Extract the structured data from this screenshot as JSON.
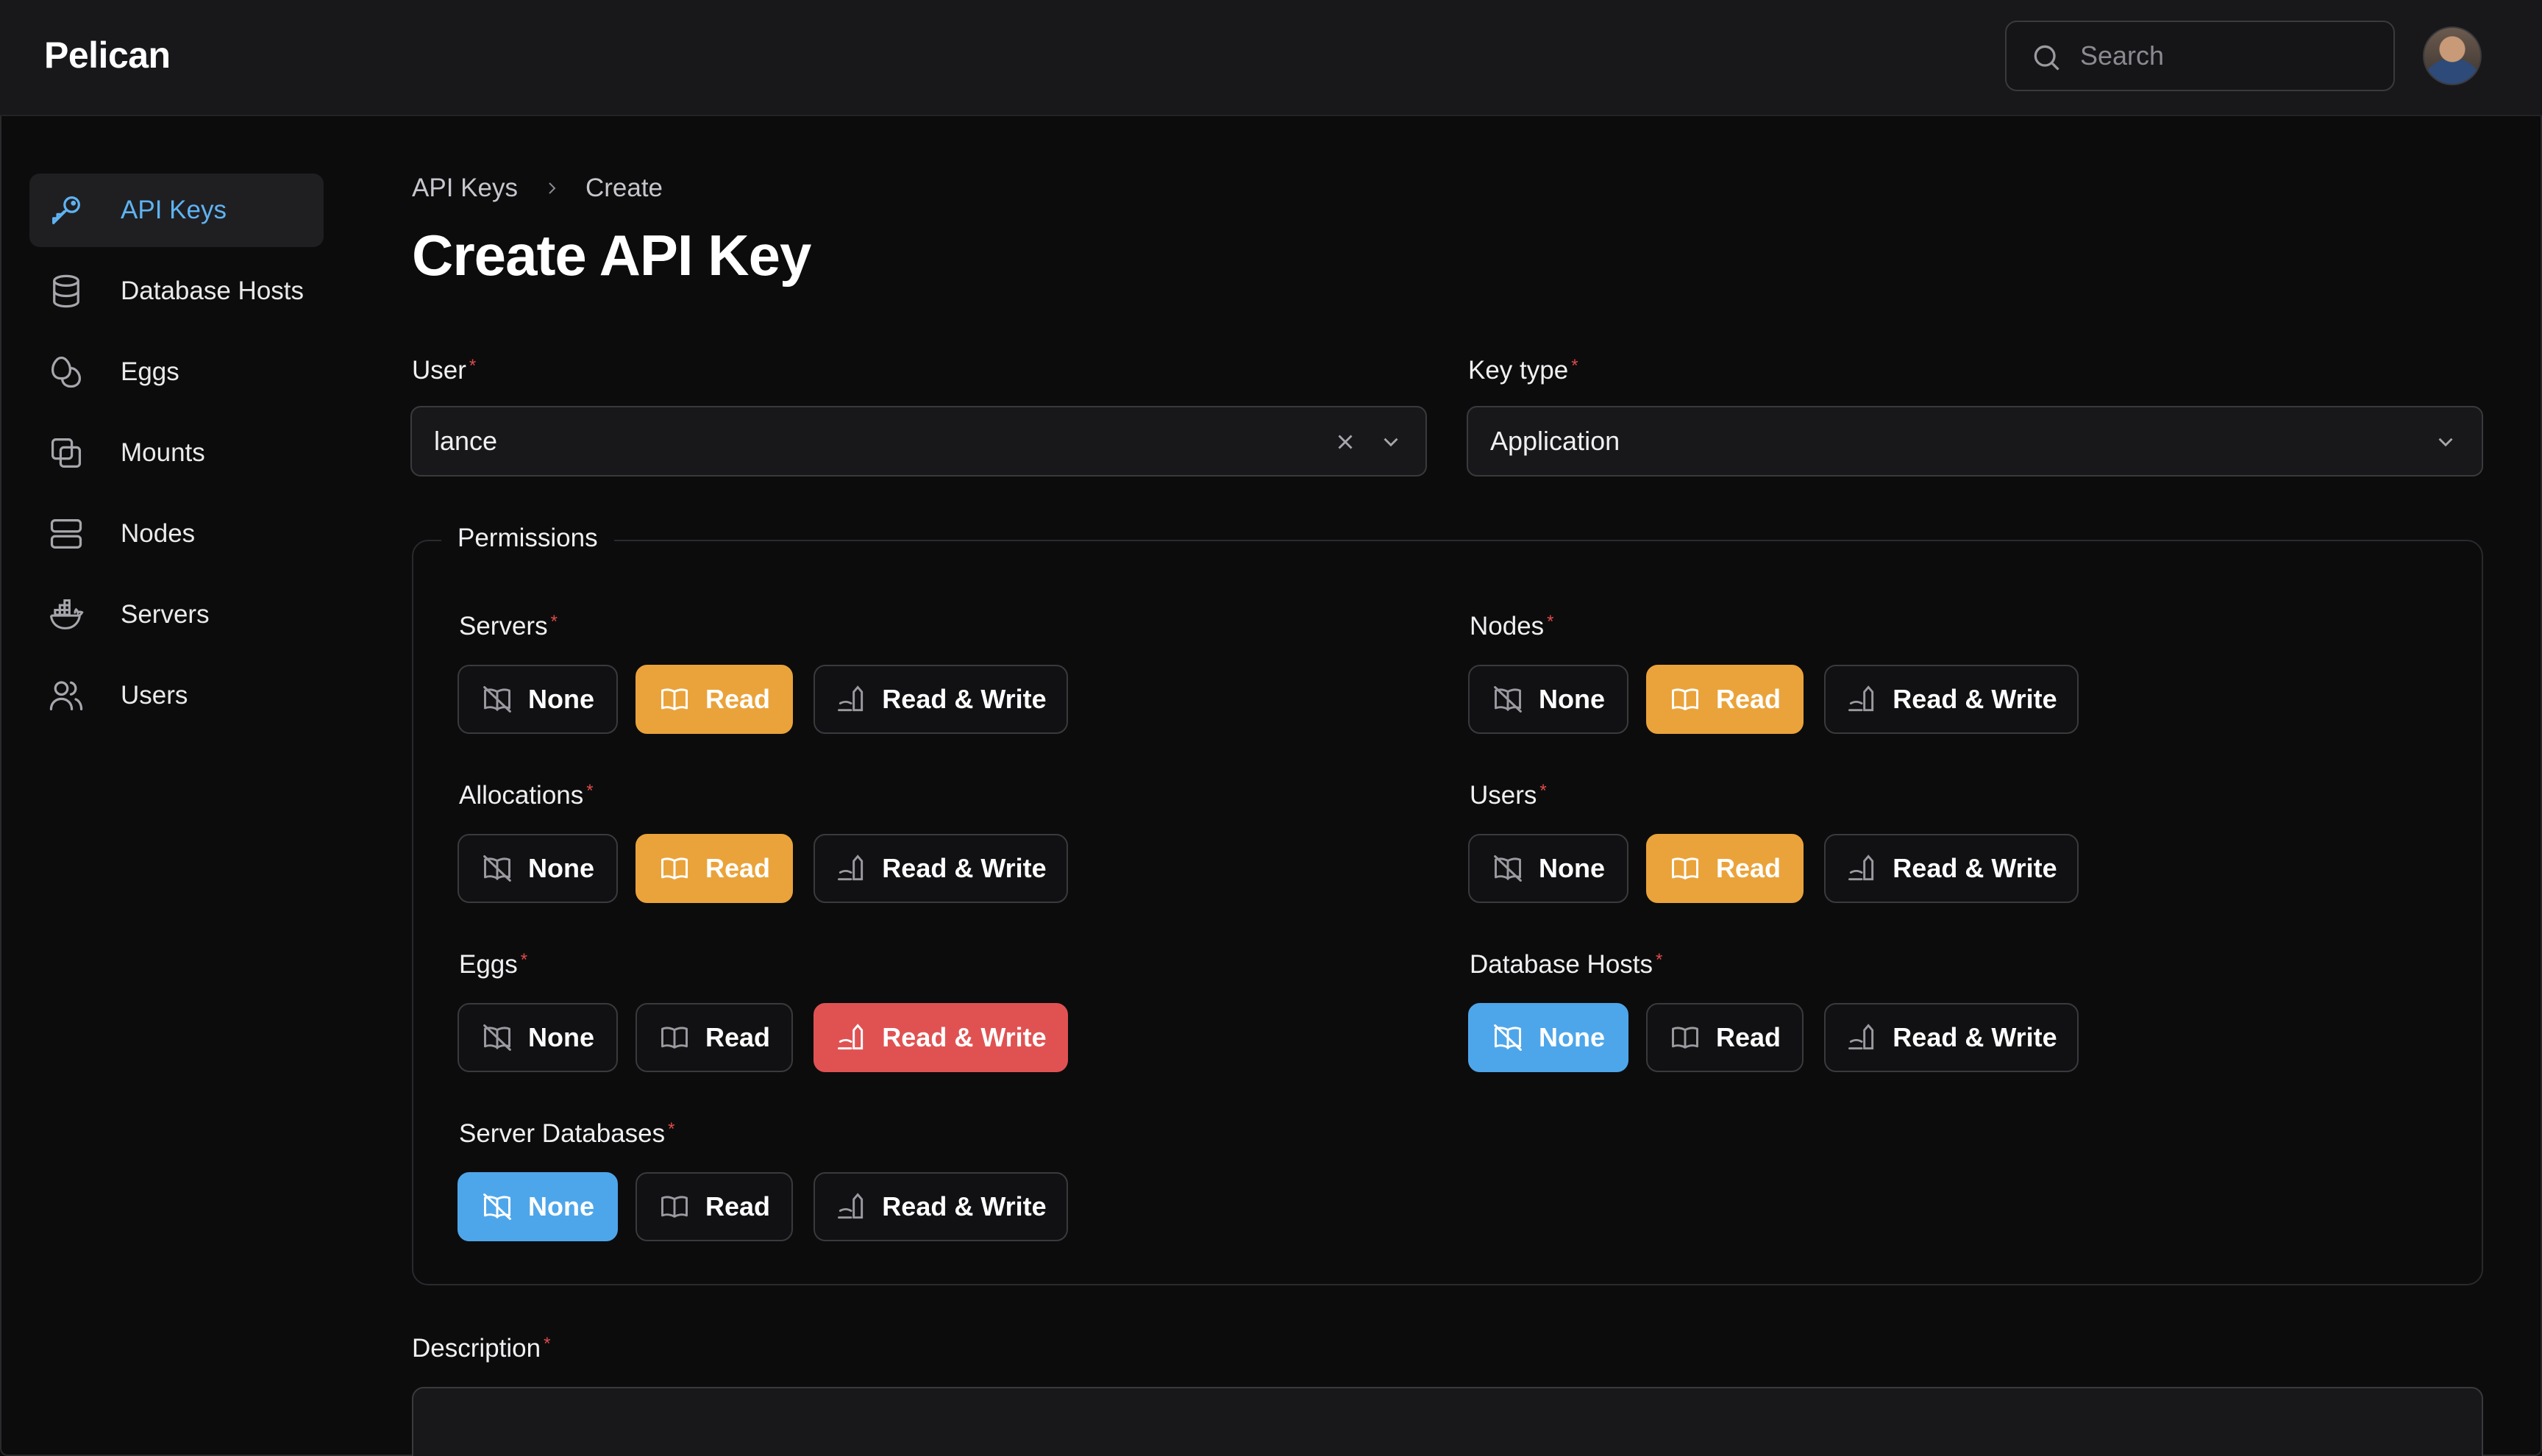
{
  "app": {
    "brand": "Pelican"
  },
  "search": {
    "placeholder": "Search"
  },
  "sidebar": {
    "items": [
      {
        "label": "API Keys",
        "icon": "key-icon",
        "active": true
      },
      {
        "label": "Database Hosts",
        "icon": "database-icon"
      },
      {
        "label": "Eggs",
        "icon": "eggs-icon"
      },
      {
        "label": "Mounts",
        "icon": "mounts-icon"
      },
      {
        "label": "Nodes",
        "icon": "server-stack-icon"
      },
      {
        "label": "Servers",
        "icon": "docker-icon"
      },
      {
        "label": "Users",
        "icon": "users-icon"
      }
    ]
  },
  "breadcrumb": {
    "parent": "API Keys",
    "current": "Create"
  },
  "page": {
    "title": "Create API Key"
  },
  "form": {
    "user": {
      "label": "User",
      "value": "lance"
    },
    "key_type": {
      "label": "Key type",
      "value": "Application"
    },
    "permissions_legend": "Permissions",
    "description": {
      "label": "Description"
    }
  },
  "permission_options": {
    "none": "None",
    "read": "Read",
    "read_write": "Read & Write"
  },
  "permissions": [
    {
      "name": "Servers",
      "selected": "read"
    },
    {
      "name": "Nodes",
      "selected": "read"
    },
    {
      "name": "Allocations",
      "selected": "read"
    },
    {
      "name": "Users",
      "selected": "read"
    },
    {
      "name": "Eggs",
      "selected": "read_write"
    },
    {
      "name": "Database Hosts",
      "selected": "none"
    },
    {
      "name": "Server Databases",
      "selected": "none"
    }
  ],
  "colors": {
    "accent_blue": "#4ea6ea",
    "read_selected": "#eaa33a",
    "read_write_selected": "#e05252",
    "required_star": "#e04a4a"
  }
}
